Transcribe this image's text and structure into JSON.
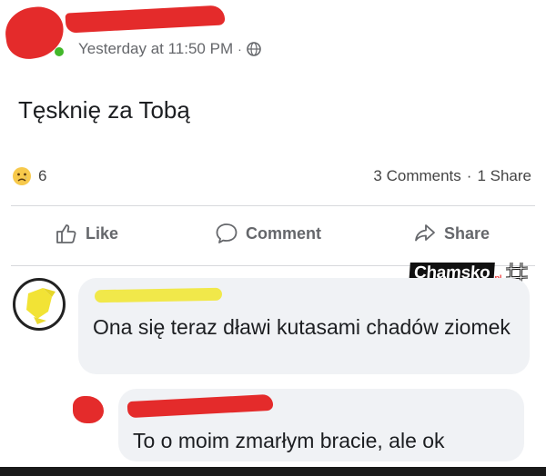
{
  "post": {
    "timestamp": "Yesterday at 11:50 PM",
    "separator": "·",
    "privacy_icon": "globe-icon",
    "text": "Tęsknię za Tobą"
  },
  "reactions": {
    "emoji": "sad-reaction-icon",
    "count": "6",
    "comments": "3 Comments",
    "separator": "·",
    "shares": "1 Share"
  },
  "actions": {
    "like": "Like",
    "comment": "Comment",
    "share": "Share"
  },
  "watermark": {
    "text": "Chamsko",
    "suffix": "pl"
  },
  "comments": [
    {
      "text": "Ona się teraz dławi kutasami chadów ziomek"
    },
    {
      "text": "To o moim zmarłym bracie, ale ok"
    }
  ],
  "colors": {
    "redaction": "#e42b2b",
    "redaction_yellow": "#f1e84a",
    "bubble": "#f0f2f5",
    "secondary_text": "#65676b"
  }
}
